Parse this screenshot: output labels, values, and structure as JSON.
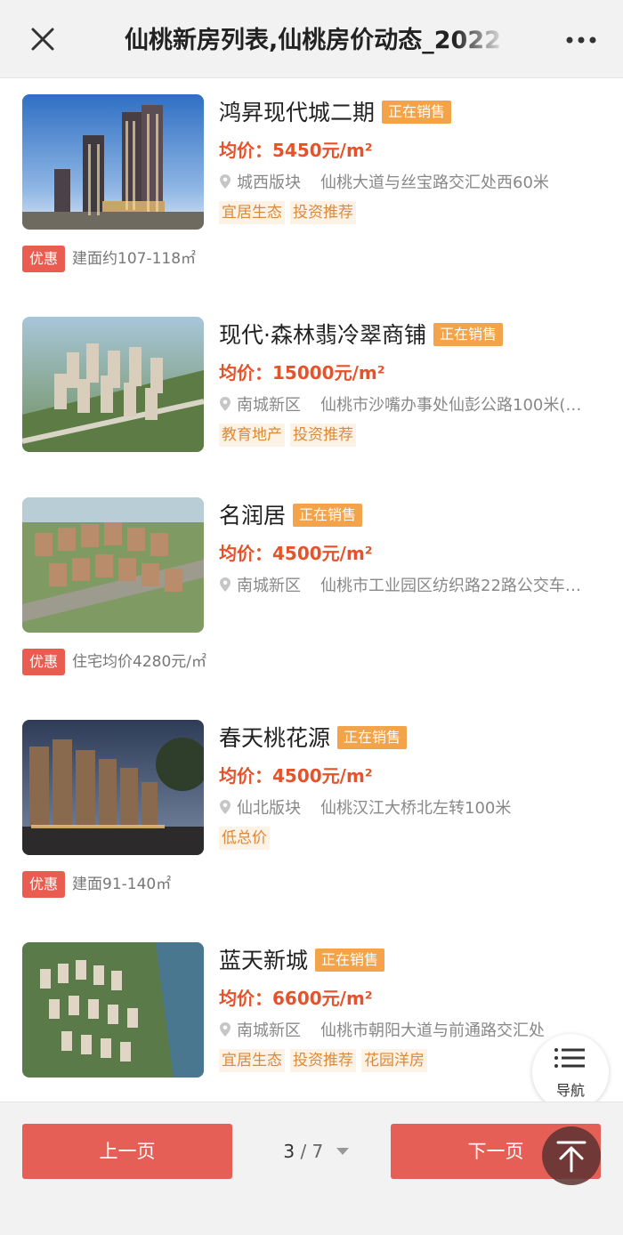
{
  "header": {
    "title": "仙桃新房列表,仙桃房价动态_2022"
  },
  "listings": [
    {
      "name": "鸿昇现代城二期",
      "status": "正在销售",
      "price_label": "均价：",
      "price": "5450元/m²",
      "district": "城西版块",
      "address": "仙桃大道与丝宝路交汇处西60米",
      "tags": [
        "宜居生态",
        "投资推荐"
      ],
      "promo_badge": "优惠",
      "promo_text": "建面约107-118㎡"
    },
    {
      "name": "现代·森林翡冷翠商铺",
      "status": "正在销售",
      "price_label": "均价：",
      "price": "15000元/m²",
      "district": "南城新区",
      "address": "仙桃市沙嘴办事处仙彭公路100米(…",
      "tags": [
        "教育地产",
        "投资推荐"
      ]
    },
    {
      "name": "名润居",
      "status": "正在销售",
      "price_label": "均价：",
      "price": "4500元/m²",
      "district": "南城新区",
      "address": "仙桃市工业园区纺织路22路公交车…",
      "tags": [],
      "promo_badge": "优惠",
      "promo_text": "住宅均价4280元/㎡"
    },
    {
      "name": "春天桃花源",
      "status": "正在销售",
      "price_label": "均价：",
      "price": "4500元/m²",
      "district": "仙北版块",
      "address": "仙桃汉江大桥北左转100米",
      "tags": [
        "低总价"
      ],
      "promo_badge": "优惠",
      "promo_text": "建面91-140㎡"
    },
    {
      "name": "蓝天新城",
      "status": "正在销售",
      "price_label": "均价：",
      "price": "6600元/m²",
      "district": "南城新区",
      "address": "仙桃市朝阳大道与前通路交汇处",
      "tags": [
        "宜居生态",
        "投资推荐",
        "花园洋房"
      ]
    }
  ],
  "pagination": {
    "prev_label": "上一页",
    "next_label": "下一页",
    "current": "3",
    "separator": "/",
    "total": "7"
  },
  "fab": {
    "nav_label": "导航"
  },
  "colors": {
    "price": "#e6532b",
    "status_badge": "#f3a34a",
    "promo_badge": "#e95c4f",
    "page_button": "#e65f56"
  }
}
